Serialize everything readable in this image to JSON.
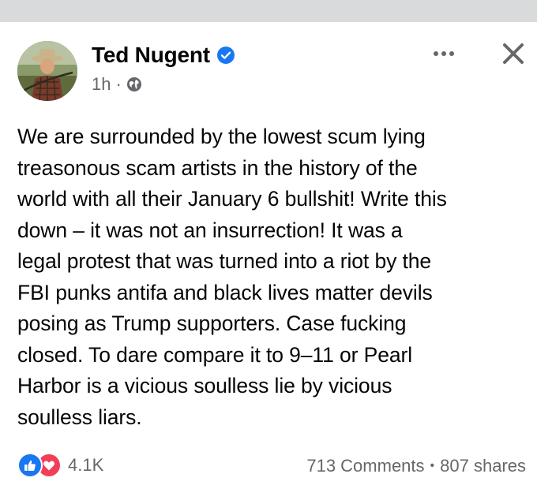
{
  "post": {
    "author": "Ted Nugent",
    "time": "1h",
    "separator": "·",
    "text": "We are surrounded by the lowest scum lying\ntreasonous scam artists in the history of the\nworld with all their January 6 bullshit! Write this\ndown – it was not an insurrection! It was a\nlegal protest that was turned into a riot by the\nFBI punks antifa and black lives matter devils\nposing as Trump supporters. Case fucking\nclosed. To dare compare it to 9–11 or Pearl\nHarbor is a vicious soulless lie by vicious\nsoulless liars."
  },
  "footer": {
    "reactions_count": "4.1K",
    "comments": "713 Comments",
    "stats_separator": "•",
    "shares": "807 shares"
  },
  "icons": {
    "verified": "verified-badge-icon",
    "audience": "globe-icon",
    "more": "more-options-icon",
    "close": "close-icon",
    "like": "like-reaction-icon",
    "love": "love-reaction-icon"
  },
  "colors": {
    "verified_blue": "#1877f2",
    "like_blue": "#1877f2",
    "love_red": "#f33e58",
    "secondary_text": "#65676b",
    "top_strip": "#d9dadc"
  }
}
